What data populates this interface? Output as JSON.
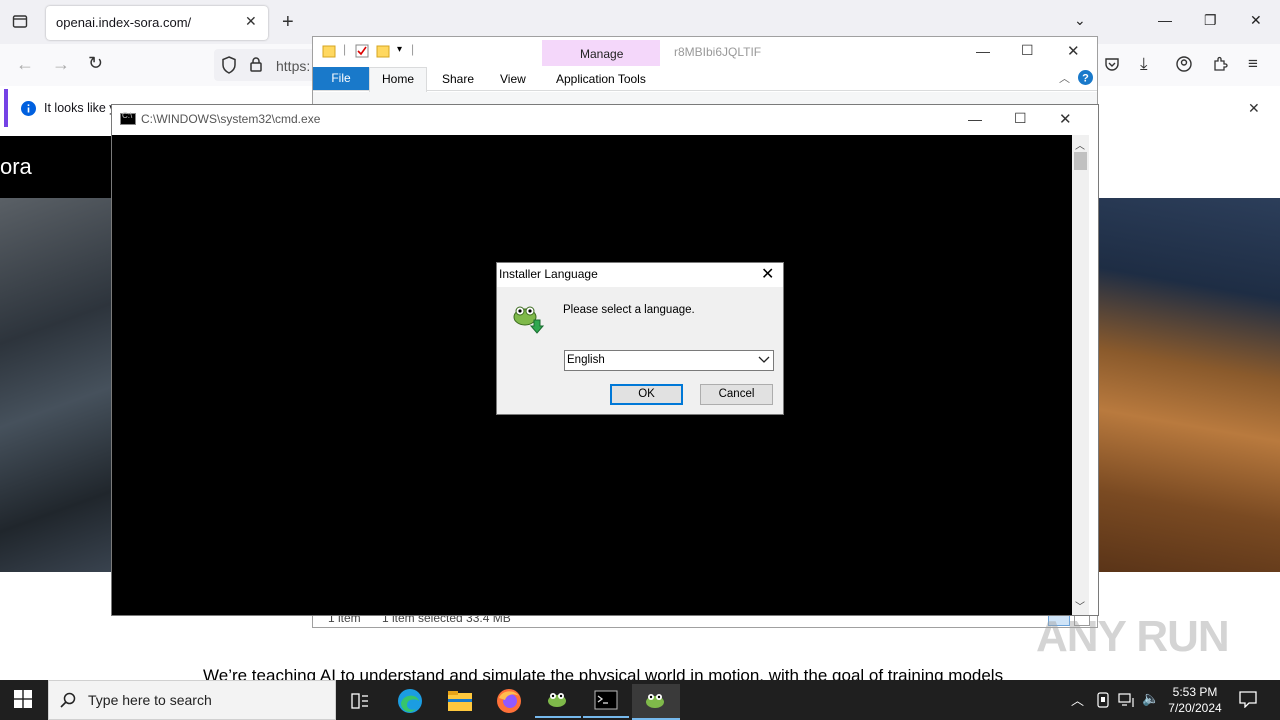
{
  "browser": {
    "tab_title": "openai.index-sora.com/",
    "url_partial": "https:",
    "info_text": "It looks like y"
  },
  "page": {
    "brand_partial": "ora",
    "body_text": "We’re teaching AI to understand and simulate the physical world in motion, with the goal of training models"
  },
  "explorer": {
    "manage_label": "Manage",
    "window_title": "r8MBIbi6JQLTIF",
    "tabs": {
      "file": "File",
      "home": "Home",
      "share": "Share",
      "view": "View",
      "app_tools": "Application Tools"
    },
    "status_items": "1 item",
    "status_selected": "1 item selected  33.4 MB"
  },
  "cmd": {
    "title": "C:\\WINDOWS\\system32\\cmd.exe"
  },
  "dialog": {
    "title": "Installer Language",
    "prompt": "Please select a language.",
    "selected_language": "English",
    "ok_label": "OK",
    "cancel_label": "Cancel"
  },
  "watermark": "ANY RUN",
  "taskbar": {
    "search_placeholder": "Type here to search",
    "time": "5:53 PM",
    "date": "7/20/2024"
  },
  "colors": {
    "firefox_accent": "#7542e5",
    "explorer_file_tab": "#1979ca",
    "manage_tab": "#f4d7fa",
    "dialog_ok_focus": "#0078d7",
    "taskbar": "#1f1f1f"
  }
}
